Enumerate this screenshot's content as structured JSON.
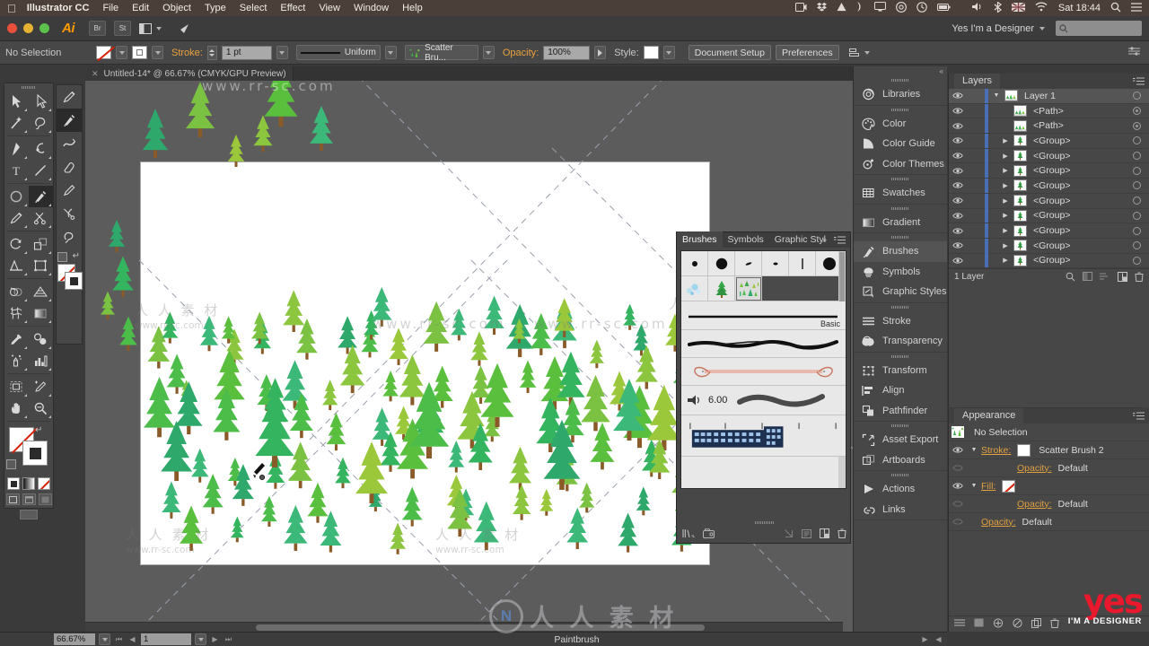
{
  "macbar": {
    "apple_icon": "apple-icon",
    "app_name": "Illustrator CC",
    "menus": [
      "File",
      "Edit",
      "Object",
      "Type",
      "Select",
      "Effect",
      "View",
      "Window",
      "Help"
    ],
    "status_icons": [
      "screen-record-icon",
      "dropbox-icon",
      "google-drive-icon",
      "moon-icon",
      "display-icon",
      "creative-cloud-icon",
      "time-machine-icon",
      "battery-icon"
    ],
    "right_icons": [
      "volume-icon",
      "bluetooth-icon",
      "uk-flag-icon",
      "wifi-icon"
    ],
    "clock": "Sat 18:44",
    "search_icon": "spotlight-search-icon",
    "list_icon": "notification-center-icon"
  },
  "titlebar": {
    "logo": "Ai",
    "bridge_label": "Br",
    "stock_label": "St",
    "arrange_icon": "arrange-documents-icon",
    "behance_icon": "behance-share-icon",
    "workspace": "Yes I'm a Designer",
    "search_placeholder": ""
  },
  "controlbar": {
    "selection_status": "No Selection",
    "fill_label": "fill-swatch-none",
    "stroke_swatch_label": "stroke-swatch-white",
    "stroke_label": "Stroke:",
    "stroke_weight": "1 pt",
    "profile_label": "Uniform",
    "brush_definition": "Scatter Bru...",
    "opacity_label": "Opacity:",
    "opacity_value": "100%",
    "style_label": "Style:",
    "document_setup": "Document Setup",
    "preferences": "Preferences",
    "align_icon": "align-to-selection-icon"
  },
  "document": {
    "tab_title": "Untitled-14* @ 66.67% (CMYK/GPU Preview)",
    "close_icon": "close-tab-icon"
  },
  "tools": {
    "main": [
      [
        "selection-tool",
        "direct-selection-tool"
      ],
      [
        "magic-wand-tool",
        "lasso-tool"
      ],
      [
        "pen-tool",
        "curvature-tool"
      ],
      [
        "type-tool",
        "line-segment-tool"
      ],
      [
        "ellipse-tool",
        "paintbrush-tool"
      ],
      [
        "pencil-tool",
        "scissors-tool"
      ],
      [
        "rotate-tool",
        "scale-tool"
      ],
      [
        "width-tool",
        "free-transform-tool"
      ],
      [
        "shape-builder-tool",
        "perspective-grid-tool"
      ],
      [
        "mesh-tool",
        "gradient-tool"
      ],
      [
        "eyedropper-tool",
        "blend-tool"
      ],
      [
        "symbol-sprayer-tool",
        "column-graph-tool"
      ],
      [
        "artboard-tool",
        "slice-tool"
      ],
      [
        "hand-tool",
        "zoom-tool"
      ]
    ],
    "selected": "paintbrush-tool",
    "secondary": [
      "pencil-tool",
      "paintbrush-tool",
      "smooth-tool",
      "eraser-tool",
      "pencil-alt-tool",
      "scissors-alt-tool",
      "lasso-alt-tool"
    ],
    "secondary_selected": "paintbrush-tool",
    "fill_stroke": {
      "fill": "none-swatch",
      "stroke": "white-swatch",
      "swap_icon": "swap-fill-stroke-icon",
      "default_icon": "default-fill-stroke-icon"
    },
    "modes": [
      "color-mode",
      "gradient-mode",
      "none-mode"
    ],
    "screen_modes": [
      "normal-screen-mode",
      "full-screen-menu-mode",
      "full-screen-mode"
    ]
  },
  "statusbar": {
    "zoom": "66.67%",
    "page": "1",
    "tool_name": "Paintbrush",
    "nav_first": "first-page-icon",
    "nav_prev": "previous-page-icon",
    "nav_next": "next-page-icon",
    "nav_last": "last-page-icon"
  },
  "dock": {
    "collapse_icon": "collapse-panels-icon",
    "groups": [
      {
        "items": [
          {
            "label": "Libraries",
            "icon": "libraries-icon",
            "active": false
          }
        ]
      },
      {
        "items": [
          {
            "label": "Color",
            "icon": "color-icon",
            "active": false
          },
          {
            "label": "Color Guide",
            "icon": "color-guide-icon",
            "active": false
          },
          {
            "label": "Color Themes",
            "icon": "color-themes-icon",
            "active": false
          }
        ]
      },
      {
        "items": [
          {
            "label": "Swatches",
            "icon": "swatches-icon",
            "active": false
          }
        ]
      },
      {
        "items": [
          {
            "label": "Gradient",
            "icon": "gradient-icon",
            "active": false
          }
        ]
      },
      {
        "items": [
          {
            "label": "Brushes",
            "icon": "brushes-icon",
            "active": true
          },
          {
            "label": "Symbols",
            "icon": "symbols-icon",
            "active": false
          },
          {
            "label": "Graphic Styles",
            "icon": "graphic-styles-icon",
            "active": false
          }
        ]
      },
      {
        "items": [
          {
            "label": "Stroke",
            "icon": "stroke-icon",
            "active": false
          },
          {
            "label": "Transparency",
            "icon": "transparency-icon",
            "active": false
          }
        ]
      },
      {
        "items": [
          {
            "label": "Transform",
            "icon": "transform-icon",
            "active": false
          },
          {
            "label": "Align",
            "icon": "align-icon",
            "active": false
          },
          {
            "label": "Pathfinder",
            "icon": "pathfinder-icon",
            "active": false
          }
        ]
      },
      {
        "items": [
          {
            "label": "Asset Export",
            "icon": "asset-export-icon",
            "active": false
          },
          {
            "label": "Artboards",
            "icon": "artboards-icon",
            "active": false
          }
        ]
      },
      {
        "items": [
          {
            "label": "Actions",
            "icon": "actions-icon",
            "active": false
          },
          {
            "label": "Links",
            "icon": "links-icon",
            "active": false
          }
        ]
      }
    ]
  },
  "layers_panel": {
    "title": "Layers",
    "menu_icon": "panel-menu-icon",
    "rows": [
      {
        "name": "Layer 1",
        "expanded": true,
        "indent": 0,
        "has_triangle": true,
        "thumb": "forest-thumb",
        "target_filled": false,
        "top": true
      },
      {
        "name": "<Path>",
        "expanded": false,
        "indent": 1,
        "has_triangle": false,
        "thumb": "path-thumb",
        "target_filled": true,
        "top": false
      },
      {
        "name": "<Path>",
        "expanded": false,
        "indent": 1,
        "has_triangle": false,
        "thumb": "path-thumb",
        "target_filled": true,
        "top": false
      },
      {
        "name": "<Group>",
        "expanded": false,
        "indent": 1,
        "has_triangle": true,
        "thumb": "tree-thumb",
        "target_filled": false,
        "top": false
      },
      {
        "name": "<Group>",
        "expanded": false,
        "indent": 1,
        "has_triangle": true,
        "thumb": "tree-thumb",
        "target_filled": false,
        "top": false
      },
      {
        "name": "<Group>",
        "expanded": false,
        "indent": 1,
        "has_triangle": true,
        "thumb": "tree-thumb",
        "target_filled": false,
        "top": false
      },
      {
        "name": "<Group>",
        "expanded": false,
        "indent": 1,
        "has_triangle": true,
        "thumb": "tree-thumb",
        "target_filled": false,
        "top": false
      },
      {
        "name": "<Group>",
        "expanded": false,
        "indent": 1,
        "has_triangle": true,
        "thumb": "tree-thumb",
        "target_filled": false,
        "top": false
      },
      {
        "name": "<Group>",
        "expanded": false,
        "indent": 1,
        "has_triangle": true,
        "thumb": "tree-thumb",
        "target_filled": false,
        "top": false
      },
      {
        "name": "<Group>",
        "expanded": false,
        "indent": 1,
        "has_triangle": true,
        "thumb": "tree-thumb",
        "target_filled": false,
        "top": false
      },
      {
        "name": "<Group>",
        "expanded": false,
        "indent": 1,
        "has_triangle": true,
        "thumb": "tree-thumb",
        "target_filled": false,
        "top": false
      },
      {
        "name": "<Group>",
        "expanded": false,
        "indent": 1,
        "has_triangle": true,
        "thumb": "tree-thumb",
        "target_filled": false,
        "top": false
      }
    ],
    "footer_count": "1 Layer",
    "footer_icons": [
      "locate-object-icon",
      "make-clipping-mask-icon",
      "create-sublayer-icon",
      "new-layer-icon",
      "delete-layer-icon"
    ]
  },
  "appearance_panel": {
    "title": "Appearance",
    "menu_icon": "panel-menu-icon",
    "header_icon": "scatter-brush-thumb",
    "header_label": "No Selection",
    "rows": [
      {
        "kind": "stroke",
        "eye": true,
        "triangle": true,
        "label": "Stroke:",
        "swatch": "white-swatch",
        "value": "Scatter Brush 2",
        "indent": 0
      },
      {
        "kind": "opacity",
        "eye": false,
        "triangle": false,
        "label": "Opacity:",
        "value": "Default",
        "indent": 1
      },
      {
        "kind": "fill",
        "eye": true,
        "triangle": true,
        "label": "Fill:",
        "swatch": "none-swatch",
        "value": "",
        "indent": 0
      },
      {
        "kind": "opacity",
        "eye": false,
        "triangle": false,
        "label": "Opacity:",
        "value": "Default",
        "indent": 1
      },
      {
        "kind": "opacity",
        "eye": false,
        "triangle": false,
        "label": "Opacity:",
        "value": "Default",
        "indent": 0
      }
    ],
    "footer_icons": [
      "add-new-stroke-icon",
      "add-new-fill-icon",
      "add-effect-icon",
      "clear-appearance-icon",
      "duplicate-item-icon",
      "delete-item-icon"
    ]
  },
  "brushes_panel": {
    "tabs": [
      {
        "label": "Brushes",
        "active": true
      },
      {
        "label": "Symbols",
        "active": false
      },
      {
        "label": "Graphic Styl",
        "active": false
      }
    ],
    "overflow_icon": "panel-overflow-icon",
    "menu_icon": "panel-menu-icon",
    "calligraphic": [
      "3 pt Round",
      "5 pt Round",
      "Fude",
      "Dot",
      "Thin",
      "10 pt Round"
    ],
    "scatter_art": [
      {
        "name": "snow-scatter-brush",
        "selected": false
      },
      {
        "name": "tree-scatter-brush",
        "selected": false
      },
      {
        "name": "scatter-brush-2",
        "selected": true
      }
    ],
    "basic_label": "Basic",
    "bristle_size": "6.00",
    "rows": [
      {
        "name": "basic-stroke-row",
        "caption": "Basic"
      },
      {
        "name": "charcoal-art-brush-row",
        "caption": ""
      },
      {
        "name": "rope-pattern-brush-row",
        "caption": ""
      },
      {
        "name": "bristle-brush-row",
        "caption": ""
      },
      {
        "name": "pattern-brush-row",
        "caption": ""
      }
    ],
    "footer_icons": [
      "libraries-menu-icon",
      "brush-libraries-icon",
      "remove-brush-link-icon",
      "options-of-selected-object-icon",
      "new-brush-icon",
      "delete-brush-icon"
    ]
  },
  "canvas": {
    "background_color": "#5c5c5c",
    "artboard_color": "#ffffff",
    "cursor": "paintbrush-cursor",
    "watermarks": [
      {
        "text": "人 人 素 材",
        "sub": "www.rr-sc.com"
      }
    ],
    "tree_colors": [
      "#35b45f",
      "#4dbd4a",
      "#2fa86b",
      "#7cc242",
      "#9ac83a",
      "#5bbf3e",
      "#3cb878",
      "#8cc63f"
    ],
    "trunk_color": "#8a5a28"
  },
  "branding": {
    "center_watermark": "人 人 素 材",
    "logo_main": "yes",
    "logo_sub": "I'M A DESIGNER"
  }
}
